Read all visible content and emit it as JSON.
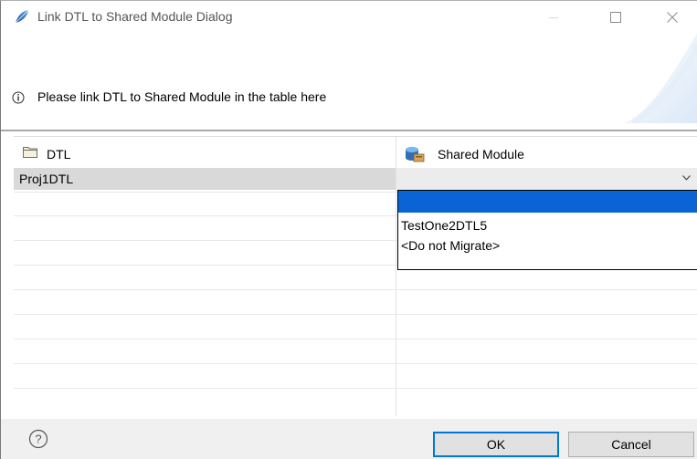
{
  "window": {
    "title": "Link DTL to Shared Module Dialog",
    "controls": [
      "minimize-icon",
      "maximize-icon",
      "close-icon"
    ]
  },
  "banner": {
    "message": "Please link DTL to Shared Module in the table here",
    "icon": "info-icon"
  },
  "table": {
    "columns": [
      {
        "label": "DTL",
        "icon": "folder-icon"
      },
      {
        "label": "Shared Module",
        "icon": "shared-module-icon"
      }
    ],
    "rows": [
      {
        "dtl": "Proj1DTL",
        "shared_module": ""
      }
    ]
  },
  "dropdown": {
    "options": [
      "",
      "TestOne2DTL5",
      "<Do not Migrate>"
    ],
    "highlighted_index": 0
  },
  "footer": {
    "ok_label": "OK",
    "cancel_label": "Cancel",
    "help_icon": "help-icon"
  },
  "colors": {
    "selection_blue": "#0a64d6",
    "row_selected": "#d9d9d9",
    "ok_border": "#0078d7",
    "footer_bg": "#f0f0f0"
  }
}
